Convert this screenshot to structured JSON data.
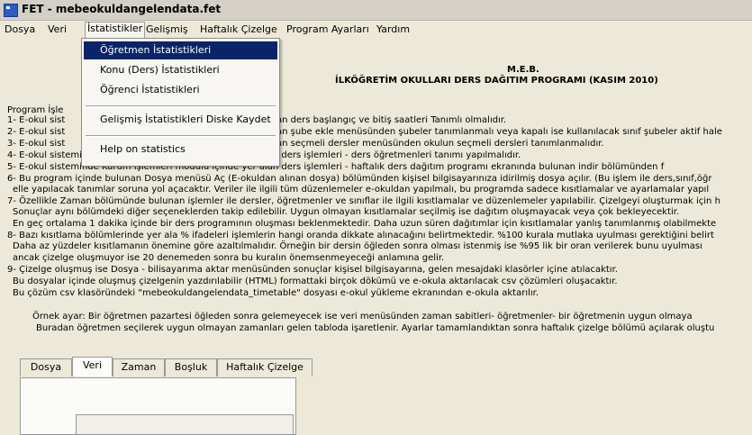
{
  "window": {
    "title": "FET - mebeokuldangelendata.fet"
  },
  "menubar": {
    "dosya": "Dosya",
    "veri": "Veri",
    "istatistikler": "İstatistikler",
    "gelismis": "Gelişmiş",
    "haftalik": "Haftalık Çizelge",
    "program_ayarlari": "Program Ayarları",
    "yardim": "Yardım"
  },
  "dropdown": {
    "ogretmen": "Öğretmen İstatistikleri",
    "konu": "Konu (Ders) İstatistikleri",
    "ogrenci": "Öğrenci İstatistikleri",
    "gelismis_kaydet": "Gelişmiş İstatistikleri Diske Kaydet",
    "help": "Help on statistics"
  },
  "header": {
    "line1": "M.E.B.",
    "line2": "İLKÖĞRETİM OKULLARI DERS DAĞITIM PROGRAMI (KASIM 2010)"
  },
  "body": {
    "intro": "Program İşle",
    "l1a": "1- E-okul sist",
    "l1b": "an ders başlangıç ve bitiş saatleri Tanımlı olmalıdır.",
    "l2a": "2- E-okul sist",
    "l2b": "an şube ekle menüsünden şubeler tanımlanmalı veya kapalı ise kullanılacak sınıf şubeler aktif hale",
    "l3a": "3- E-okul sist",
    "l3b": "an seçmeli dersler menüsünden okulun seçmeli dersleri tanımlanmalıdır.",
    "l4": "4- E-okul sisteminde Kurum İşlemleri modülü içinde yer alan ders işlemleri - ders öğretmenleri tanımı yapılmalıdır.",
    "l5": "5- E-okul sisteminde Kurum İşlemleri modülü içinde yer alan  ders işlemleri - haftalık ders dağıtım programı ekranında bulunan indir bölümünden f",
    "l6": "6- Bu program içinde bulunan Dosya menüsü Aç (E-okuldan alınan dosya) bölümünden kişisel bilgisayarınıza idirilmiş dosya açılır. (Bu işlem ile ders,sınıf,öğr",
    "l6b": "elle yapılacak tanımlar soruna yol açacaktır. Veriler ile ilgili tüm düzenlemeler e-okuldan yapılmalı, bu programda sadece kısıtlamalar ve ayarlamalar yapıl",
    "l7": "7- Özellikle Zaman bölümünde bulunan işlemler ile dersler, öğretmenler ve sınıflar ile ilgili kısıtlamalar ve düzenlemeler yapılabilir. Çizelgeyi oluşturmak için h",
    "l7b": "Sonuçlar aynı bölümdeki diğer seçeneklerden takip edilebilir. Uygun olmayan kısıtlamalar seçilmiş ise dağıtım oluşmayacak veya çok bekleyecektir.",
    "l7c": "En geç ortalama 1 dakika içinde bir ders programının oluşması beklenmektedir. Daha uzun süren dağıtımlar için kısıtlamalar yanlış tanımlanmış olabilmekte",
    "l8": "8- Bazı kısıtlama bölümlerinde yer ala % ifadeleri işlemlerin hangi oranda dikkate alınacağını belirtmektedir. %100 kurala mutlaka uyulması gerektiğini belirt",
    "l8b": "Daha az yüzdeler kısıtlamanın önemine göre azaltılmalıdır. Örneğin bir dersin öğleden sonra olması istenmiş ise %95 lik bir oran verilerek bunu uyulması",
    "l8c": "ancak çizelge oluşmuyor ise 20 denemeden sonra bu kuralın önemsenmeyeceği anlamına gelir.",
    "l9": "9- Çizelge oluşmuş ise Dosya - bilisayarıma aktar menüsünden sonuçlar kişisel bilgisayarına, gelen mesajdaki klasörler içine atılacaktır.",
    "l9b": "Bu dosyalar içinde oluşmuş çizelgenin yazdırılabilir (HTML) formattaki birçok dökümü ve e-okula aktarılacak csv çözümleri oluşacaktır.",
    "l9c": "Bu çözüm csv klasöründeki \"mebeokuldangelendata_timetable\" dosyası e-okul yükleme ekranından e-okula aktarılır.",
    "ex1": "Örnek ayar: Bir öğretmen pazartesi öğleden sonra gelemeyecek ise veri menüsünden  zaman sabitleri- öğretmenler- bir öğretmenin uygun olmaya",
    "ex2": "Buradan öğretmen seçilerek uygun olmayan zamanları gelen tabloda işaretlenir. Ayarlar tamamlandıktan sonra haftalık çizelge bölümü açılarak oluştu"
  },
  "tabs": [
    "Dosya",
    "Veri",
    "Zaman",
    "Boşluk",
    "Haftalık Çizelge"
  ],
  "colors": {
    "menu_highlight": "#0a246a",
    "window_bg": "#ece9d8"
  }
}
